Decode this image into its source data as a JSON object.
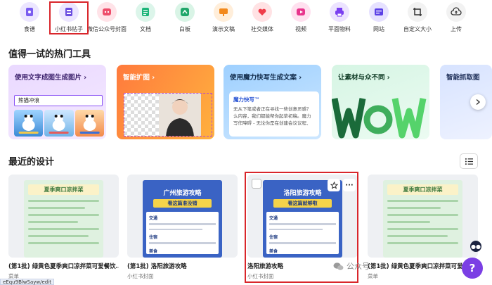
{
  "categories": [
    {
      "label": "食谱",
      "icon": "recipe-icon",
      "color": "#7a5cf0"
    },
    {
      "label": "小红书帖子",
      "icon": "xiaohongshu-post-icon",
      "color": "#7a5cf0"
    },
    {
      "label": "微信公众号封面",
      "icon": "wechat-cover-icon",
      "color": "#ee4d6a"
    },
    {
      "label": "文档",
      "icon": "document-icon",
      "color": "#1db57a"
    },
    {
      "label": "白板",
      "icon": "whiteboard-icon",
      "color": "#1fa66a"
    },
    {
      "label": "演示文稿",
      "icon": "presentation-icon",
      "color": "#f2891c"
    },
    {
      "label": "社交媒体",
      "icon": "heart-icon",
      "color": "#ef3d4a"
    },
    {
      "label": "视频",
      "icon": "video-icon",
      "color": "#e8358d"
    },
    {
      "label": "平面物料",
      "icon": "print-icon",
      "color": "#7a3ff0"
    },
    {
      "label": "网站",
      "icon": "website-icon",
      "color": "#5b40e6"
    },
    {
      "label": "自定义大小",
      "icon": "crop-icon",
      "color": "#333333"
    },
    {
      "label": "上传",
      "icon": "upload-cloud-icon",
      "color": "#333333"
    }
  ],
  "hot_tools": {
    "title": "值得一试的热门工具",
    "items": [
      {
        "title": "使用文字成图生成图片 ›",
        "prompt_value": "熊猫冲浪"
      },
      {
        "title": "智能扩图 ›"
      },
      {
        "title": "使用魔力快写生成文案 ›",
        "card_heading": "魔力快写™",
        "card_text": "无从下笔或者正在寻找一些创意灵感？么内容，我们都能帮你起草初稿。魔力写作障碍 - 无论你是在创建会议议程、"
      },
      {
        "title": "让素材与众不同 ›"
      },
      {
        "title": "智能抓取图"
      }
    ]
  },
  "recent": {
    "title": "最近的设计",
    "designs": [
      {
        "title": "(第1批) 绿黄色夏季爽口凉拌菜可爱餐饮...",
        "type": "菜单",
        "thumb_title": "夏季爽口凉拌菜"
      },
      {
        "title": "(第1批) 洛阳旅游攻略",
        "type": "小红书封面",
        "thumb_title": "广州旅游攻略",
        "thumb_sub": "看这篇准没错",
        "thumb_sections": [
          "交通",
          "住宿",
          "美食"
        ]
      },
      {
        "title": "洛阳旅游攻略",
        "type": "小红书封面",
        "thumb_title": "洛阳旅游攻略",
        "thumb_sub": "看这篇就够啦",
        "thumb_sections": [
          "交通",
          "住宿",
          "美食"
        ]
      },
      {
        "title": "(第1批) 绿黄色夏季爽口凉拌菜可爱餐饮分享...",
        "type": "菜单",
        "thumb_title": "夏季爽口凉拌菜"
      }
    ]
  },
  "watermark": "公众号 · 一",
  "help_label": "?",
  "status_url": "eEqu9BlwSayw/edit"
}
